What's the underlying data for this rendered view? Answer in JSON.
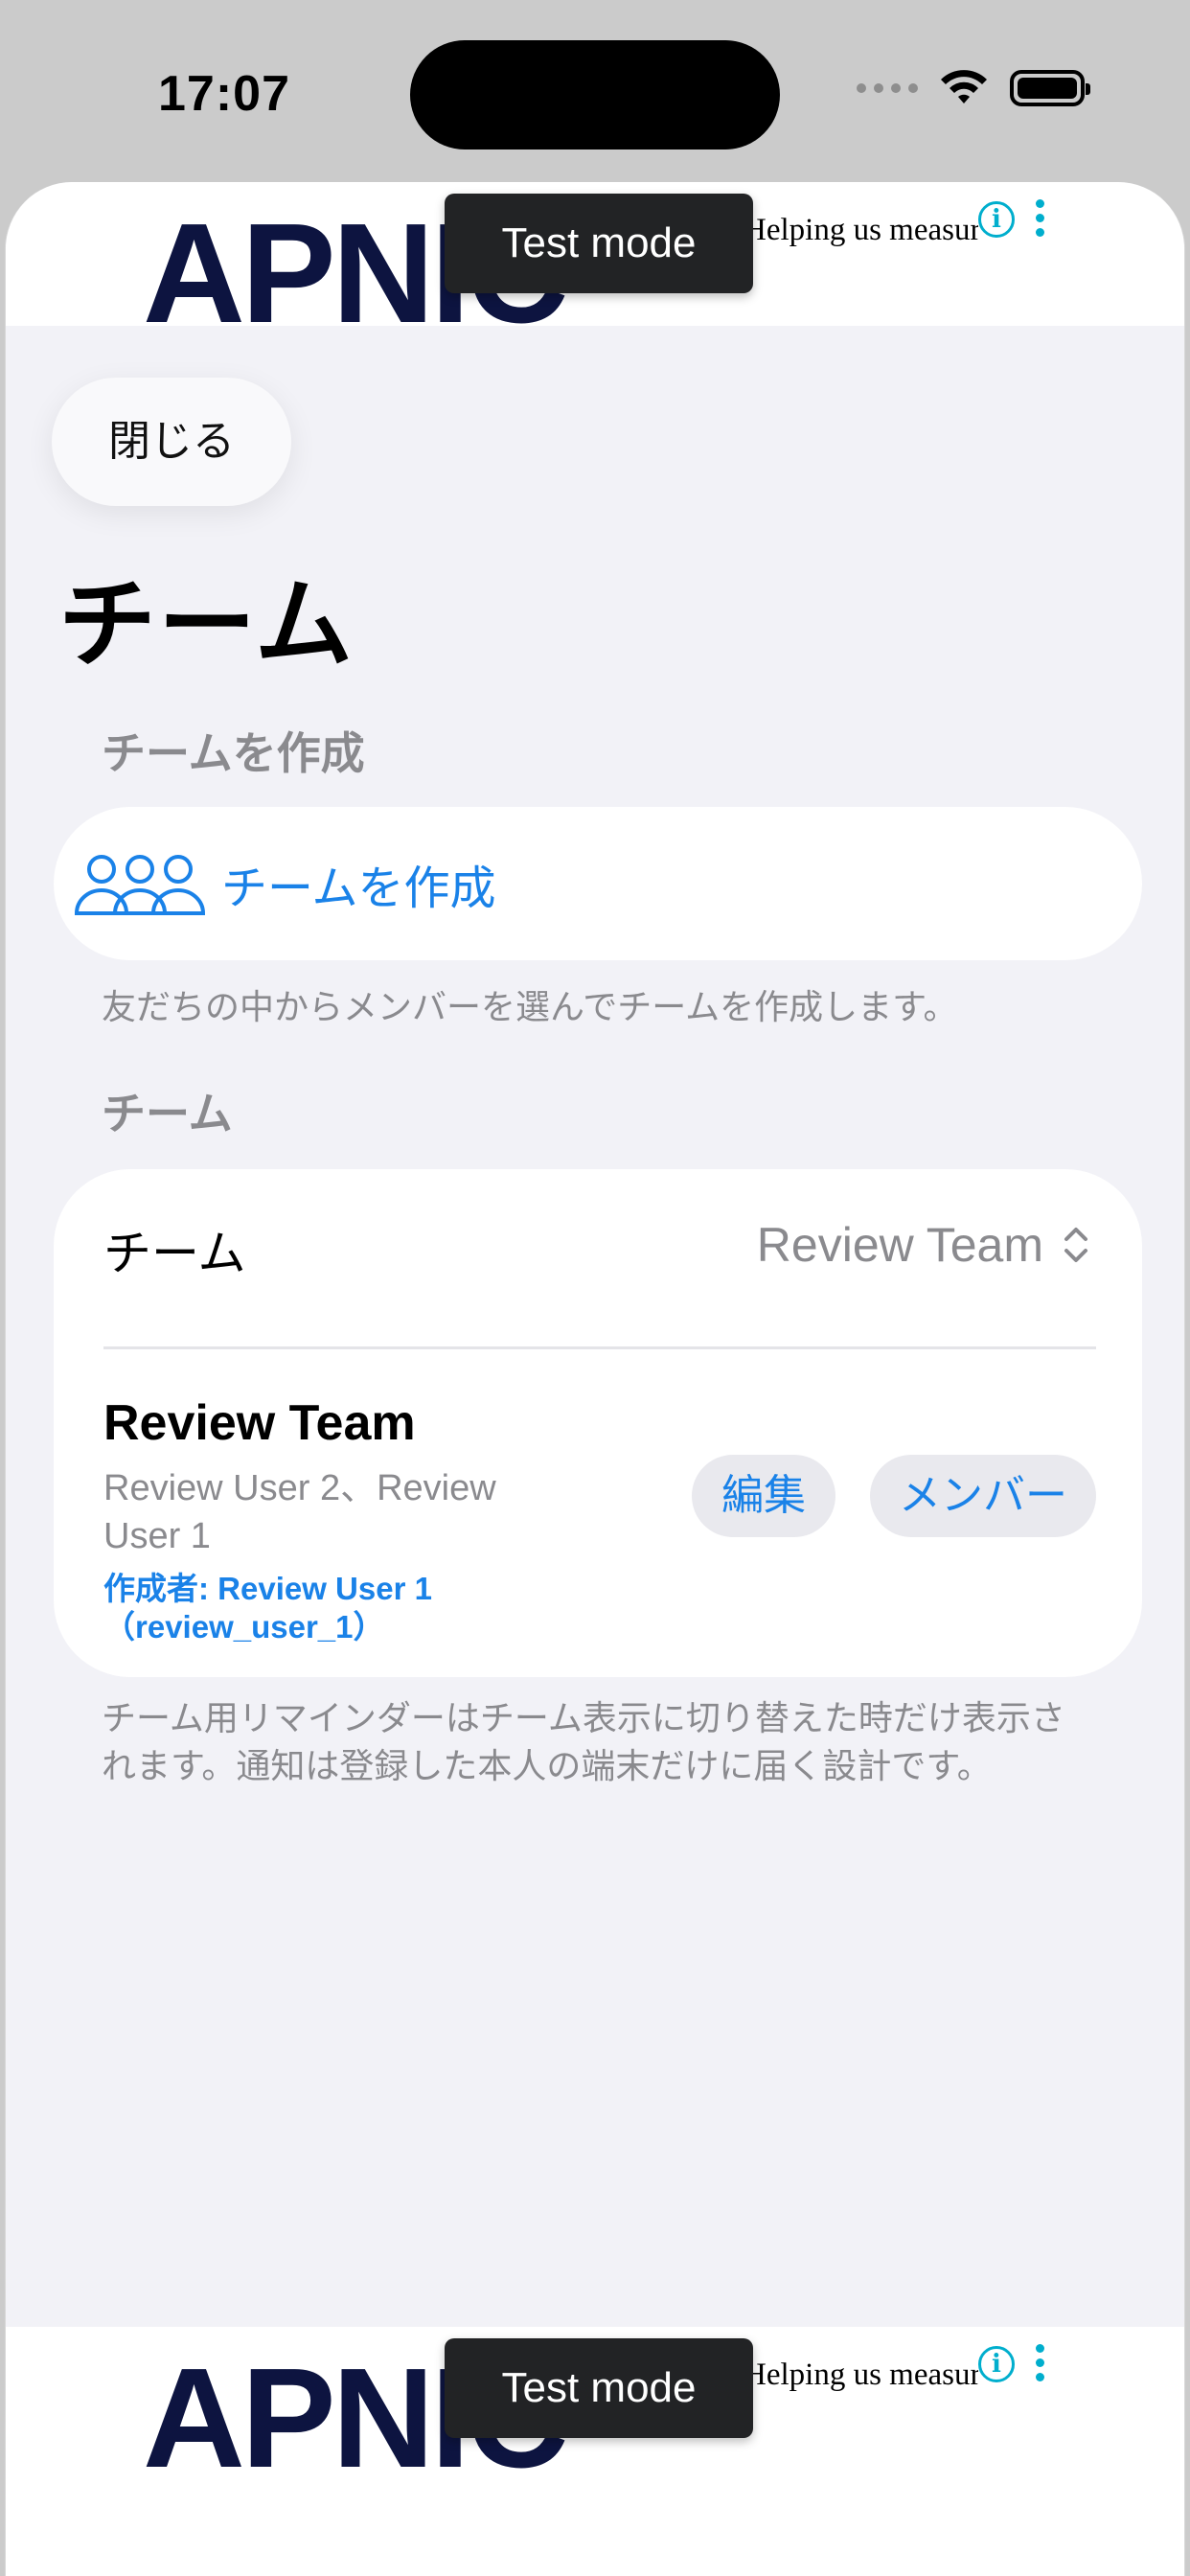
{
  "status_bar": {
    "time": "17:07"
  },
  "ads": {
    "top": {
      "logo": "APNIC",
      "text": "Helping us measure",
      "badge": "Test mode"
    },
    "bottom": {
      "logo": "APNIC",
      "text": "Helping us measure",
      "badge": "Test mode"
    }
  },
  "close_button": {
    "label": "閉じる"
  },
  "page_title": "チーム",
  "create_section": {
    "header": "チームを作成",
    "button_label": "チームを作成",
    "footnote": "友だちの中からメンバーを選んでチームを作成します。"
  },
  "team_section": {
    "header": "チーム",
    "row_label": "チーム",
    "selected_team": "Review Team",
    "team": {
      "name": "Review Team",
      "members": "Review User 2、Review User 1",
      "creator": "作成者: Review User 1（review_user_1）",
      "edit_label": "編集",
      "members_label": "メンバー"
    },
    "footnote": "チーム用リマインダーはチーム表示に切り替えた時だけ表示されます。通知は登録した本人の端末だけに届く設計です。"
  },
  "colors": {
    "accent": "#1a82e8",
    "secondary_text": "#8a8a8e",
    "background": "#f2f2f7"
  },
  "icons": [
    "wifi-icon",
    "battery-icon",
    "people-icon",
    "chevron-updown-icon",
    "info-icon",
    "more-icon"
  ]
}
